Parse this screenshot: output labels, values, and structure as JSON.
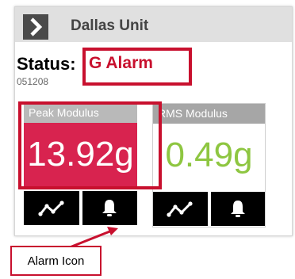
{
  "header": {
    "title": "Dallas Unit",
    "icon": "chevron-right-icon"
  },
  "status": {
    "label": "Status:",
    "value": "G Alarm",
    "id": "051208"
  },
  "tiles": [
    {
      "title": "Peak Modulus",
      "value": "13.92g",
      "color": "#d8234f"
    },
    {
      "title": "RMS Modulus",
      "value": "0.49g",
      "color": "#8ec641"
    }
  ],
  "tile_buttons": {
    "trend_icon": "trend-icon",
    "alarm_icon": "bell-icon"
  },
  "annotation": {
    "label": "Alarm Icon",
    "color": "#c8102e"
  }
}
